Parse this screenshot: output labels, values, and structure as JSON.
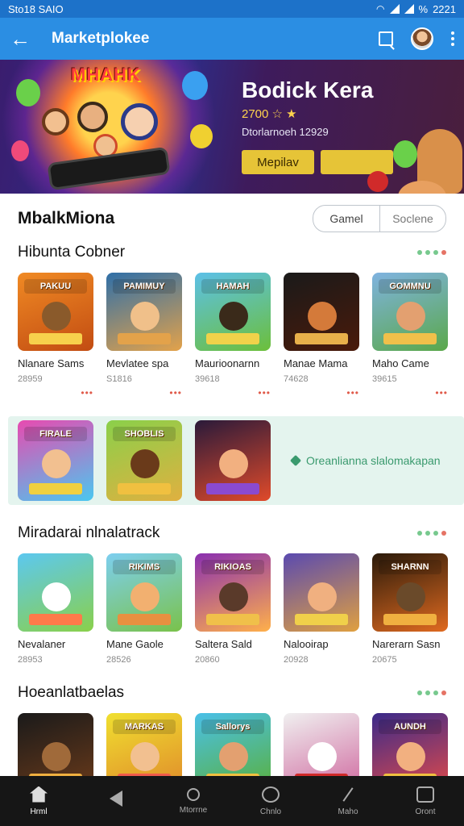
{
  "status": {
    "left": "Sto18 SAIO",
    "right": "2221",
    "battery": "%"
  },
  "appbar": {
    "title": "Marketplokee"
  },
  "banner": {
    "logo": "MHAHK",
    "title": "Bodick Kera",
    "rating": "2700 ☆ ★",
    "subtitle": "Dtorlarnoeh 12929",
    "button": "Mepilav"
  },
  "market": {
    "title": "MbalkMiona",
    "toggle": [
      "Gamel",
      "Soclene"
    ]
  },
  "sections": [
    {
      "title": "Hibunta Cobner",
      "apps": [
        {
          "name": "Nlanare Sams",
          "meta": "28959",
          "caption": "PAKUU",
          "bg": "#f08a24",
          "bg2": "#c24c12",
          "face": "#8a5a2b",
          "plate": "#f7d14c"
        },
        {
          "name": "Mevlatee spa",
          "meta": "S1816",
          "caption": "PAMIMUY",
          "bg": "#2f6fa8",
          "bg2": "#e3a24a",
          "face": "#f0c08a",
          "plate": "#e3a24a"
        },
        {
          "name": "Maurioonarnn",
          "meta": "39618",
          "caption": "HAMAH",
          "bg": "#5cc0e8",
          "bg2": "#6cbf3a",
          "face": "#3a2a1a",
          "plate": "#f0d24a"
        },
        {
          "name": "Manae Mama",
          "meta": "74628",
          "caption": "",
          "bg": "#1a1a1a",
          "bg2": "#4a1a0a",
          "face": "#d47a3a",
          "plate": "#e8b04a"
        },
        {
          "name": "Maho Came",
          "meta": "39615",
          "caption": "GOMMNU",
          "bg": "#7fb3e0",
          "bg2": "#5aa84a",
          "face": "#e3a070",
          "plate": "#f0c04a"
        }
      ]
    },
    {
      "title": "Miradarai nlnalatrack",
      "apps": [
        {
          "name": "Nevalaner",
          "meta": "28953",
          "caption": "",
          "bg": "#5cc8f0",
          "bg2": "#8ad04a",
          "face": "#ffffff",
          "plate": "#ff7a4a"
        },
        {
          "name": "Mane Gaole",
          "meta": "28526",
          "caption": "RIKIMS",
          "bg": "#7dcff0",
          "bg2": "#7ac24a",
          "face": "#f2b070",
          "plate": "#e89040"
        },
        {
          "name": "Saltera Sald",
          "meta": "20860",
          "caption": "RIKIOAS",
          "bg": "#8a2fb0",
          "bg2": "#ffb04a",
          "face": "#5a3a2a",
          "plate": "#f0c04a"
        },
        {
          "name": "Nalooirap",
          "meta": "20928",
          "caption": "",
          "bg": "#5a4ab0",
          "bg2": "#e0a040",
          "face": "#f0b080",
          "plate": "#f0d04a"
        },
        {
          "name": "Narerarn Sasn",
          "meta": "20675",
          "caption": "SHARNN",
          "bg": "#2a1a0a",
          "bg2": "#e06a20",
          "face": "#6a4a2a",
          "plate": "#f0b040"
        }
      ]
    },
    {
      "title": "Hoeanlatbaelas",
      "apps": [
        {
          "name": "",
          "meta": "",
          "caption": "",
          "bg": "#1a1a1a",
          "bg2": "#6a3a1a",
          "face": "#a06a3a",
          "plate": "#f0b040"
        },
        {
          "name": "",
          "meta": "",
          "caption": "MARKAS",
          "bg": "#f0e030",
          "bg2": "#e08a2a",
          "face": "#f2c090",
          "plate": "#f05a4a"
        },
        {
          "name": "",
          "meta": "",
          "caption": "Sallorys",
          "bg": "#4ac0e8",
          "bg2": "#5ab03a",
          "face": "#e3a070",
          "plate": "#f0c040"
        },
        {
          "name": "",
          "meta": "",
          "caption": "",
          "bg": "#f0f0f0",
          "bg2": "#d06aa0",
          "face": "#ffffff",
          "plate": "#d02a2a"
        },
        {
          "name": "",
          "meta": "",
          "caption": "AUNDH",
          "bg": "#3a2a8a",
          "bg2": "#e04a4a",
          "face": "#f2b080",
          "plate": "#f0c040"
        }
      ]
    }
  ],
  "featured": {
    "apps": [
      {
        "caption": "FIRALE",
        "bg": "#e84ab0",
        "bg2": "#4ac8f0",
        "face": "#f2c090",
        "plate": "#f0d040"
      },
      {
        "caption": "SHOBLIS",
        "bg": "#8ad04a",
        "bg2": "#e0b040",
        "face": "#6a3a1a",
        "plate": "#f0c040"
      },
      {
        "caption": "",
        "bg": "#2a1a3a",
        "bg2": "#e04a2a",
        "face": "#f2b080",
        "plate": "#8a4ad0"
      }
    ],
    "promo": "Oreanlianna slalomakapan"
  },
  "nav": [
    "Hrml",
    "Mtorrne",
    "Chnlo",
    "Maho",
    "Oront"
  ]
}
